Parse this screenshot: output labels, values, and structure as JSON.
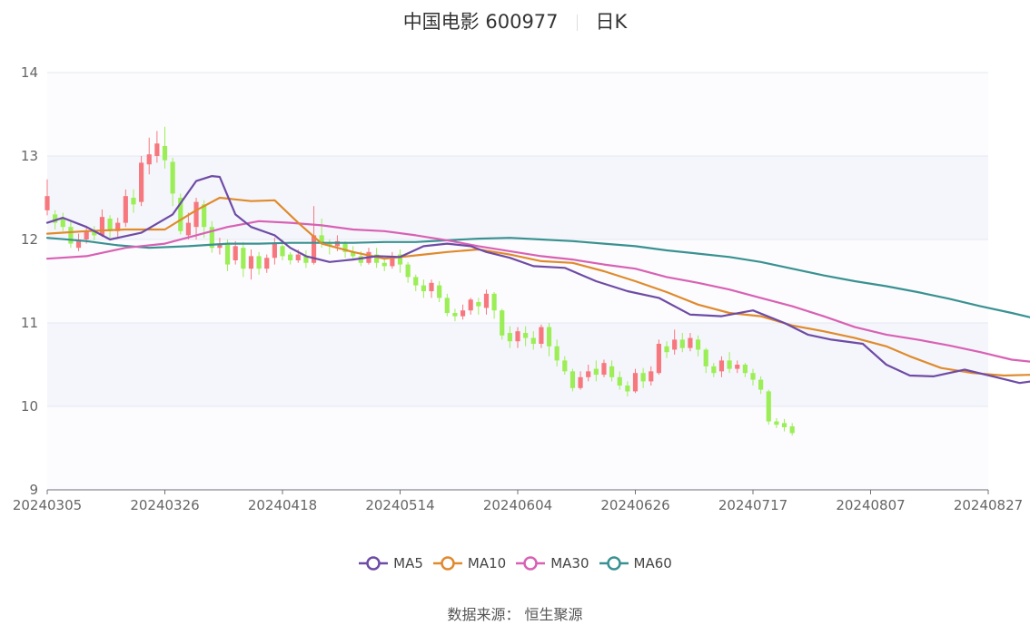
{
  "header": {
    "title": "中国电影 600977",
    "period": "日K"
  },
  "footer": {
    "source": "数据来源： 恒生聚源"
  },
  "colors": {
    "up": "#F6787E",
    "down": "#9BEE55",
    "grid_band": "#F4F6FB",
    "grid_line": "#E3E8F3"
  },
  "chart_data": {
    "type": "candlestick",
    "ylim": [
      9,
      14
    ],
    "yticks": [
      9,
      10,
      11,
      12,
      13,
      14
    ],
    "xticks": [
      "20240305",
      "20240326",
      "20240418",
      "20240514",
      "20240604",
      "20240626",
      "20240717",
      "20240807",
      "20240827"
    ],
    "n_days": 121,
    "legend": [
      {
        "name": "MA5",
        "color": "#6E4BA5"
      },
      {
        "name": "MA10",
        "color": "#E08A2D"
      },
      {
        "name": "MA30",
        "color": "#D861B4"
      },
      {
        "name": "MA60",
        "color": "#3A9191"
      }
    ],
    "ma_series": {
      "MA5": [
        [
          0,
          12.2
        ],
        [
          2,
          12.26
        ],
        [
          5,
          12.15
        ],
        [
          8,
          12.0
        ],
        [
          12,
          12.08
        ],
        [
          16,
          12.3
        ],
        [
          19,
          12.7
        ],
        [
          21,
          12.76
        ],
        [
          22,
          12.75
        ],
        [
          24,
          12.3
        ],
        [
          26,
          12.15
        ],
        [
          29,
          12.05
        ],
        [
          31,
          11.9
        ],
        [
          33,
          11.8
        ],
        [
          36,
          11.73
        ],
        [
          39,
          11.76
        ],
        [
          42,
          11.8
        ],
        [
          45,
          11.79
        ],
        [
          48,
          11.92
        ],
        [
          51,
          11.95
        ],
        [
          54,
          11.92
        ],
        [
          56,
          11.85
        ],
        [
          59,
          11.78
        ],
        [
          62,
          11.68
        ],
        [
          66,
          11.66
        ],
        [
          70,
          11.5
        ],
        [
          74,
          11.38
        ],
        [
          78,
          11.3
        ],
        [
          82,
          11.1
        ],
        [
          86,
          11.08
        ],
        [
          90,
          11.15
        ],
        [
          94,
          11.0
        ],
        [
          97,
          10.86
        ],
        [
          100,
          10.8
        ],
        [
          104,
          10.75
        ],
        [
          107,
          10.5
        ],
        [
          110,
          10.37
        ],
        [
          113,
          10.36
        ],
        [
          117,
          10.44
        ],
        [
          121,
          10.35
        ],
        [
          124,
          10.28
        ],
        [
          127,
          10.32
        ],
        [
          130,
          10.45
        ],
        [
          134,
          10.62
        ],
        [
          137,
          10.67
        ],
        [
          140,
          10.55
        ],
        [
          144,
          10.44
        ],
        [
          148,
          10.3
        ],
        [
          152,
          9.88
        ]
      ],
      "MA10": [
        [
          0,
          12.07
        ],
        [
          5,
          12.1
        ],
        [
          10,
          12.12
        ],
        [
          15,
          12.12
        ],
        [
          19,
          12.35
        ],
        [
          22,
          12.5
        ],
        [
          26,
          12.46
        ],
        [
          29,
          12.47
        ],
        [
          32,
          12.2
        ],
        [
          35,
          11.95
        ],
        [
          39,
          11.85
        ],
        [
          43,
          11.77
        ],
        [
          48,
          11.82
        ],
        [
          51,
          11.85
        ],
        [
          55,
          11.88
        ],
        [
          59,
          11.82
        ],
        [
          63,
          11.74
        ],
        [
          67,
          11.72
        ],
        [
          71,
          11.62
        ],
        [
          75,
          11.5
        ],
        [
          79,
          11.37
        ],
        [
          83,
          11.22
        ],
        [
          87,
          11.12
        ],
        [
          91,
          11.08
        ],
        [
          95,
          10.97
        ],
        [
          99,
          10.9
        ],
        [
          103,
          10.82
        ],
        [
          107,
          10.72
        ],
        [
          110,
          10.6
        ],
        [
          114,
          10.46
        ],
        [
          118,
          10.4
        ],
        [
          122,
          10.37
        ],
        [
          126,
          10.38
        ],
        [
          130,
          10.4
        ],
        [
          134,
          10.58
        ],
        [
          138,
          10.64
        ],
        [
          142,
          10.58
        ],
        [
          146,
          10.45
        ],
        [
          149,
          10.32
        ],
        [
          152,
          10.15
        ]
      ],
      "MA30": [
        [
          0,
          11.77
        ],
        [
          5,
          11.8
        ],
        [
          10,
          11.9
        ],
        [
          15,
          11.95
        ],
        [
          19,
          12.05
        ],
        [
          23,
          12.15
        ],
        [
          27,
          12.22
        ],
        [
          31,
          12.2
        ],
        [
          35,
          12.17
        ],
        [
          39,
          12.12
        ],
        [
          43,
          12.1
        ],
        [
          47,
          12.05
        ],
        [
          51,
          11.99
        ],
        [
          55,
          11.92
        ],
        [
          59,
          11.86
        ],
        [
          63,
          11.8
        ],
        [
          67,
          11.76
        ],
        [
          71,
          11.7
        ],
        [
          75,
          11.65
        ],
        [
          79,
          11.55
        ],
        [
          83,
          11.48
        ],
        [
          87,
          11.4
        ],
        [
          91,
          11.3
        ],
        [
          95,
          11.2
        ],
        [
          99,
          11.08
        ],
        [
          103,
          10.95
        ],
        [
          107,
          10.86
        ],
        [
          111,
          10.8
        ],
        [
          115,
          10.73
        ],
        [
          119,
          10.65
        ],
        [
          123,
          10.56
        ],
        [
          127,
          10.52
        ],
        [
          131,
          10.51
        ],
        [
          135,
          10.5
        ],
        [
          139,
          10.48
        ],
        [
          143,
          10.45
        ],
        [
          147,
          10.42
        ],
        [
          152,
          10.36
        ]
      ],
      "MA60": [
        [
          0,
          12.02
        ],
        [
          5,
          11.98
        ],
        [
          9,
          11.93
        ],
        [
          13,
          11.9
        ],
        [
          18,
          11.92
        ],
        [
          23,
          11.95
        ],
        [
          27,
          11.95
        ],
        [
          31,
          11.96
        ],
        [
          35,
          11.96
        ],
        [
          39,
          11.96
        ],
        [
          43,
          11.97
        ],
        [
          47,
          11.97
        ],
        [
          51,
          11.99
        ],
        [
          55,
          12.01
        ],
        [
          59,
          12.02
        ],
        [
          63,
          12.0
        ],
        [
          67,
          11.98
        ],
        [
          71,
          11.95
        ],
        [
          75,
          11.92
        ],
        [
          79,
          11.87
        ],
        [
          83,
          11.83
        ],
        [
          87,
          11.79
        ],
        [
          91,
          11.73
        ],
        [
          95,
          11.65
        ],
        [
          99,
          11.57
        ],
        [
          103,
          11.5
        ],
        [
          107,
          11.44
        ],
        [
          111,
          11.37
        ],
        [
          115,
          11.29
        ],
        [
          119,
          11.2
        ],
        [
          123,
          11.12
        ],
        [
          127,
          11.03
        ],
        [
          131,
          10.95
        ],
        [
          135,
          10.88
        ],
        [
          139,
          10.82
        ],
        [
          143,
          10.75
        ],
        [
          147,
          10.7
        ],
        [
          152,
          10.6
        ]
      ]
    },
    "candles": [
      [
        0,
        12.35,
        12.52,
        12.29,
        12.72
      ],
      [
        1,
        12.3,
        12.2,
        12.12,
        12.35
      ],
      [
        2,
        12.25,
        12.15,
        12.1,
        12.32
      ],
      [
        3,
        12.15,
        11.95,
        11.9,
        12.22
      ],
      [
        4,
        11.9,
        12.0,
        11.86,
        12.07
      ],
      [
        5,
        12.0,
        12.1,
        11.95,
        12.15
      ],
      [
        6,
        12.1,
        12.05,
        11.99,
        12.16
      ],
      [
        7,
        12.05,
        12.27,
        12.03,
        12.36
      ],
      [
        8,
        12.25,
        12.1,
        12.02,
        12.29
      ],
      [
        9,
        12.1,
        12.2,
        12.02,
        12.26
      ],
      [
        10,
        12.2,
        12.52,
        12.15,
        12.6
      ],
      [
        11,
        12.5,
        12.42,
        12.32,
        12.6
      ],
      [
        12,
        12.45,
        12.92,
        12.4,
        13.0
      ],
      [
        13,
        12.9,
        13.02,
        12.78,
        13.22
      ],
      [
        14,
        13.0,
        13.15,
        12.92,
        13.3
      ],
      [
        15,
        13.12,
        12.95,
        12.85,
        13.35
      ],
      [
        16,
        12.93,
        12.55,
        12.4,
        12.98
      ],
      [
        17,
        12.5,
        12.1,
        12.06,
        12.55
      ],
      [
        18,
        12.05,
        12.2,
        12.0,
        12.32
      ],
      [
        19,
        12.15,
        12.45,
        12.0,
        12.5
      ],
      [
        20,
        12.42,
        12.15,
        12.02,
        12.47
      ],
      [
        21,
        12.15,
        11.9,
        11.84,
        12.22
      ],
      [
        22,
        11.9,
        11.95,
        11.82,
        12.02
      ],
      [
        23,
        11.95,
        11.7,
        11.62,
        12.0
      ],
      [
        24,
        11.75,
        11.92,
        11.7,
        11.98
      ],
      [
        25,
        11.9,
        11.65,
        11.55,
        11.97
      ],
      [
        26,
        11.65,
        11.8,
        11.52,
        11.88
      ],
      [
        27,
        11.8,
        11.65,
        11.58,
        11.85
      ],
      [
        28,
        11.65,
        11.78,
        11.6,
        11.82
      ],
      [
        29,
        11.78,
        11.95,
        11.7,
        12.02
      ],
      [
        30,
        11.92,
        11.8,
        11.75,
        12.0
      ],
      [
        31,
        11.82,
        11.75,
        11.7,
        11.85
      ],
      [
        32,
        11.75,
        11.82,
        11.72,
        11.88
      ],
      [
        33,
        11.8,
        11.72,
        11.66,
        11.87
      ],
      [
        34,
        11.72,
        12.05,
        11.7,
        12.4
      ],
      [
        35,
        12.05,
        11.95,
        11.9,
        12.25
      ],
      [
        36,
        11.95,
        11.92,
        11.82,
        12.0
      ],
      [
        37,
        11.92,
        11.98,
        11.86,
        12.05
      ],
      [
        38,
        11.95,
        11.85,
        11.78,
        11.98
      ],
      [
        39,
        11.85,
        11.8,
        11.75,
        11.92
      ],
      [
        40,
        11.8,
        11.72,
        11.68,
        11.86
      ],
      [
        41,
        11.72,
        11.85,
        11.7,
        11.9
      ],
      [
        42,
        11.82,
        11.72,
        11.66,
        11.9
      ],
      [
        43,
        11.72,
        11.68,
        11.62,
        11.78
      ],
      [
        44,
        11.68,
        11.8,
        11.65,
        11.85
      ],
      [
        45,
        11.82,
        11.7,
        11.6,
        11.88
      ],
      [
        46,
        11.7,
        11.55,
        11.48,
        11.73
      ],
      [
        47,
        11.55,
        11.45,
        11.38,
        11.58
      ],
      [
        48,
        11.45,
        11.38,
        11.3,
        11.52
      ],
      [
        49,
        11.38,
        11.48,
        11.3,
        11.52
      ],
      [
        50,
        11.45,
        11.3,
        11.25,
        11.5
      ],
      [
        51,
        11.3,
        11.12,
        11.08,
        11.35
      ],
      [
        52,
        11.12,
        11.08,
        11.02,
        11.17
      ],
      [
        53,
        11.08,
        11.15,
        11.04,
        11.22
      ],
      [
        54,
        11.15,
        11.28,
        11.1,
        11.3
      ],
      [
        55,
        11.25,
        11.2,
        11.1,
        11.3
      ],
      [
        56,
        11.18,
        11.35,
        11.1,
        11.4
      ],
      [
        57,
        11.35,
        11.15,
        11.05,
        11.37
      ],
      [
        58,
        11.15,
        10.85,
        10.8,
        11.17
      ],
      [
        59,
        10.88,
        10.78,
        10.7,
        10.96
      ],
      [
        60,
        10.78,
        10.9,
        10.7,
        10.95
      ],
      [
        61,
        10.88,
        10.82,
        10.72,
        10.96
      ],
      [
        62,
        10.82,
        10.75,
        10.68,
        10.9
      ],
      [
        63,
        10.75,
        10.95,
        10.7,
        10.98
      ],
      [
        64,
        10.95,
        10.72,
        10.6,
        11.0
      ],
      [
        65,
        10.72,
        10.55,
        10.48,
        10.8
      ],
      [
        66,
        10.55,
        10.42,
        10.38,
        10.6
      ],
      [
        67,
        10.42,
        10.22,
        10.18,
        10.45
      ],
      [
        68,
        10.22,
        10.35,
        10.2,
        10.42
      ],
      [
        69,
        10.35,
        10.42,
        10.3,
        10.5
      ],
      [
        70,
        10.45,
        10.38,
        10.3,
        10.55
      ],
      [
        71,
        10.38,
        10.52,
        10.35,
        10.56
      ],
      [
        72,
        10.48,
        10.35,
        10.3,
        10.55
      ],
      [
        73,
        10.35,
        10.25,
        10.2,
        10.42
      ],
      [
        74,
        10.25,
        10.18,
        10.12,
        10.3
      ],
      [
        75,
        10.18,
        10.4,
        10.16,
        10.45
      ],
      [
        76,
        10.4,
        10.3,
        10.22,
        10.46
      ],
      [
        77,
        10.3,
        10.42,
        10.25,
        10.48
      ],
      [
        78,
        10.4,
        10.75,
        10.38,
        10.8
      ],
      [
        79,
        10.72,
        10.65,
        10.58,
        10.78
      ],
      [
        80,
        10.68,
        10.8,
        10.62,
        10.92
      ],
      [
        81,
        10.8,
        10.7,
        10.65,
        10.88
      ],
      [
        82,
        10.7,
        10.82,
        10.66,
        10.88
      ],
      [
        83,
        10.8,
        10.68,
        10.6,
        10.85
      ],
      [
        84,
        10.68,
        10.48,
        10.4,
        10.7
      ],
      [
        85,
        10.48,
        10.4,
        10.35,
        10.52
      ],
      [
        86,
        10.42,
        10.55,
        10.35,
        10.6
      ],
      [
        87,
        10.55,
        10.45,
        10.4,
        10.65
      ],
      [
        88,
        10.45,
        10.5,
        10.4,
        10.55
      ],
      [
        89,
        10.5,
        10.4,
        10.35,
        10.52
      ],
      [
        90,
        10.4,
        10.32,
        10.25,
        10.45
      ],
      [
        91,
        10.32,
        10.2,
        10.15,
        10.36
      ],
      [
        92,
        10.18,
        9.82,
        9.78,
        10.2
      ],
      [
        93,
        9.82,
        9.78,
        9.74,
        9.86
      ],
      [
        94,
        9.8,
        9.75,
        9.7,
        9.85
      ],
      [
        95,
        9.76,
        9.68,
        9.65,
        9.8
      ]
    ]
  }
}
